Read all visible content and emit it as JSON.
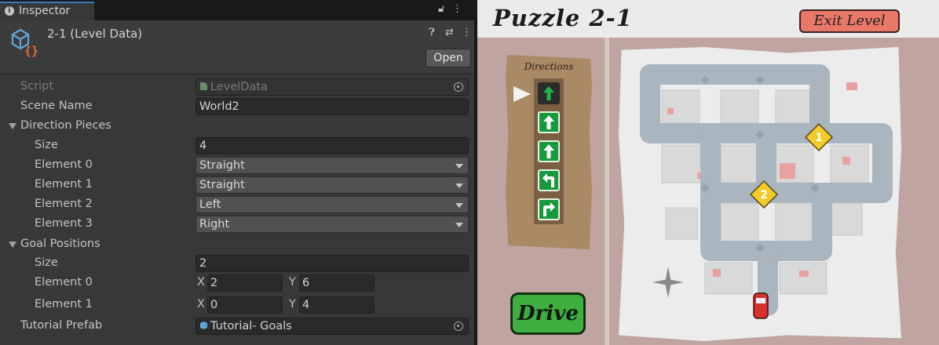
{
  "inspector": {
    "tab_label": "Inspector",
    "object_title": "2-1 (Level Data)",
    "open_button": "Open",
    "script": {
      "label": "Script",
      "value": "LevelData"
    },
    "scene_name": {
      "label": "Scene Name",
      "value": "World2"
    },
    "direction_pieces": {
      "label": "Direction Pieces",
      "size_label": "Size",
      "size": "4",
      "elements": [
        {
          "label": "Element 0",
          "value": "Straight"
        },
        {
          "label": "Element 1",
          "value": "Straight"
        },
        {
          "label": "Element 2",
          "value": "Left"
        },
        {
          "label": "Element 3",
          "value": "Right"
        }
      ]
    },
    "goal_positions": {
      "label": "Goal Positions",
      "size_label": "Size",
      "size": "2",
      "x_label": "X",
      "y_label": "Y",
      "elements": [
        {
          "label": "Element 0",
          "x": "2",
          "y": "6"
        },
        {
          "label": "Element 1",
          "x": "0",
          "y": "4"
        }
      ]
    },
    "tutorial_prefab": {
      "label": "Tutorial Prefab",
      "value": "Tutorial- Goals"
    }
  },
  "game": {
    "title": "Puzzle 2-1",
    "exit_button": "Exit Level",
    "directions_title": "Directions",
    "drive_button": "Drive",
    "direction_cards": [
      "up-arrow-icon",
      "up-arrow-icon",
      "up-arrow-icon",
      "turn-left-icon",
      "turn-right-icon"
    ],
    "goal_markers": [
      "1",
      "2"
    ],
    "colors": {
      "road": "#a9b5bf",
      "goal": "#f1cb2a",
      "card": "#169a3c",
      "drive": "#3eae3e",
      "exit": "#ea7869",
      "car": "#d8302a"
    }
  }
}
